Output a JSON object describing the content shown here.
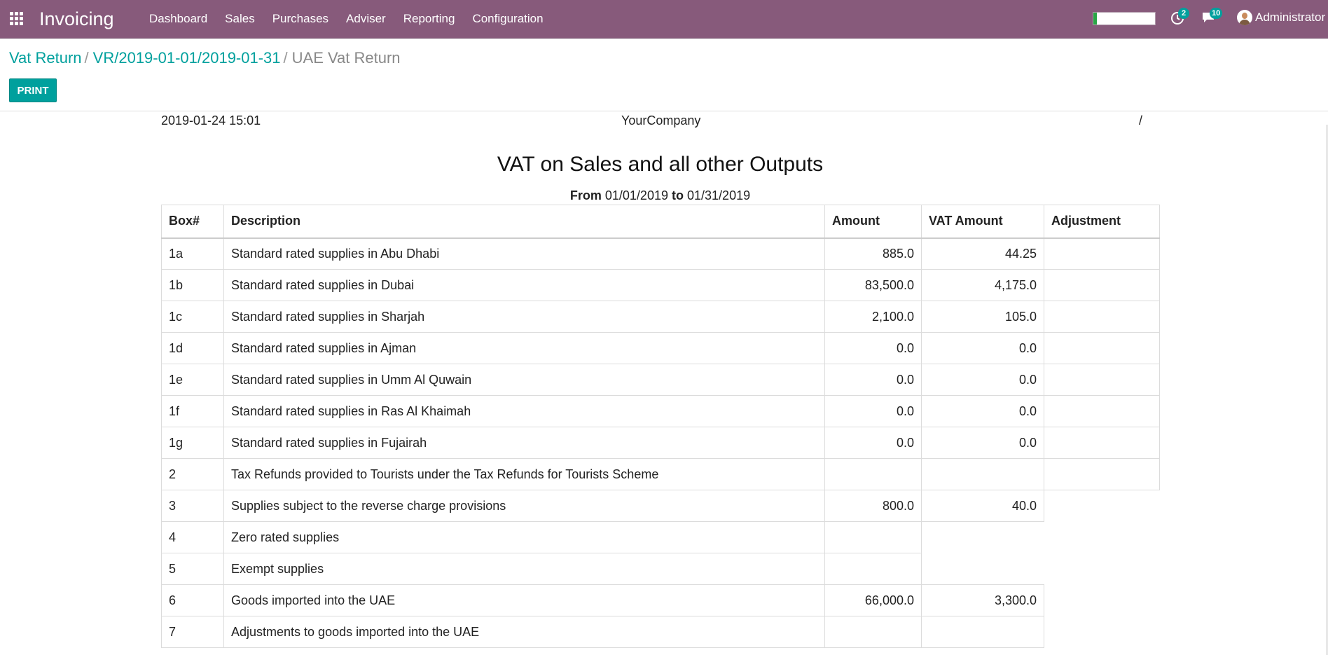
{
  "navbar": {
    "brand": "Invoicing",
    "menu": [
      "Dashboard",
      "Sales",
      "Purchases",
      "Adviser",
      "Reporting",
      "Configuration"
    ],
    "progress": 0.06,
    "activity_badge": "2",
    "messages_badge": "10",
    "user": "Administrator",
    "accent_color": "#875a7b"
  },
  "breadcrumb": {
    "items": [
      "Vat Return",
      "VR/2019-01-01/2019-01-31"
    ],
    "separator": "/",
    "active": "UAE Vat Return"
  },
  "toolbar": {
    "print_label": "PRINT"
  },
  "report": {
    "header": {
      "datetime": "2019-01-24 15:01",
      "company": "YourCompany",
      "page": "/"
    },
    "title": "VAT on Sales and all other Outputs",
    "range": {
      "from_label": "From",
      "from": "01/01/2019",
      "to_label": "to",
      "to": "01/31/2019"
    },
    "columns": [
      "Box#",
      "Description",
      "Amount",
      "VAT Amount",
      "Adjustment"
    ],
    "rows": [
      {
        "box": "1a",
        "desc": "Standard rated supplies in Abu Dhabi",
        "amount": "885.0",
        "vat": "44.25",
        "adj": ""
      },
      {
        "box": "1b",
        "desc": "Standard rated supplies in Dubai",
        "amount": "83,500.0",
        "vat": "4,175.0",
        "adj": ""
      },
      {
        "box": "1c",
        "desc": "Standard rated supplies in Sharjah",
        "amount": "2,100.0",
        "vat": "105.0",
        "adj": ""
      },
      {
        "box": "1d",
        "desc": "Standard rated supplies in Ajman",
        "amount": "0.0",
        "vat": "0.0",
        "adj": ""
      },
      {
        "box": "1e",
        "desc": "Standard rated supplies in Umm Al Quwain",
        "amount": "0.0",
        "vat": "0.0",
        "adj": ""
      },
      {
        "box": "1f",
        "desc": "Standard rated supplies in Ras Al Khaimah",
        "amount": "0.0",
        "vat": "0.0",
        "adj": ""
      },
      {
        "box": "1g",
        "desc": "Standard rated supplies in Fujairah",
        "amount": "0.0",
        "vat": "0.0",
        "adj": ""
      },
      {
        "box": "2",
        "desc": "Tax Refunds provided to Tourists under the Tax Refunds for Tourists Scheme",
        "amount": "",
        "vat": "",
        "adj": ""
      },
      {
        "box": "3",
        "desc": "Supplies subject to the reverse charge provisions",
        "amount": "800.0",
        "vat": "40.0"
      },
      {
        "box": "4",
        "desc": "Zero rated supplies",
        "amount": ""
      },
      {
        "box": "5",
        "desc": "Exempt supplies",
        "amount": ""
      },
      {
        "box": "6",
        "desc": "Goods imported into the UAE",
        "amount": "66,000.0",
        "vat": "3,300.0"
      },
      {
        "box": "7",
        "desc": "Adjustments to goods imported into the UAE",
        "amount": "",
        "vat": ""
      }
    ]
  }
}
